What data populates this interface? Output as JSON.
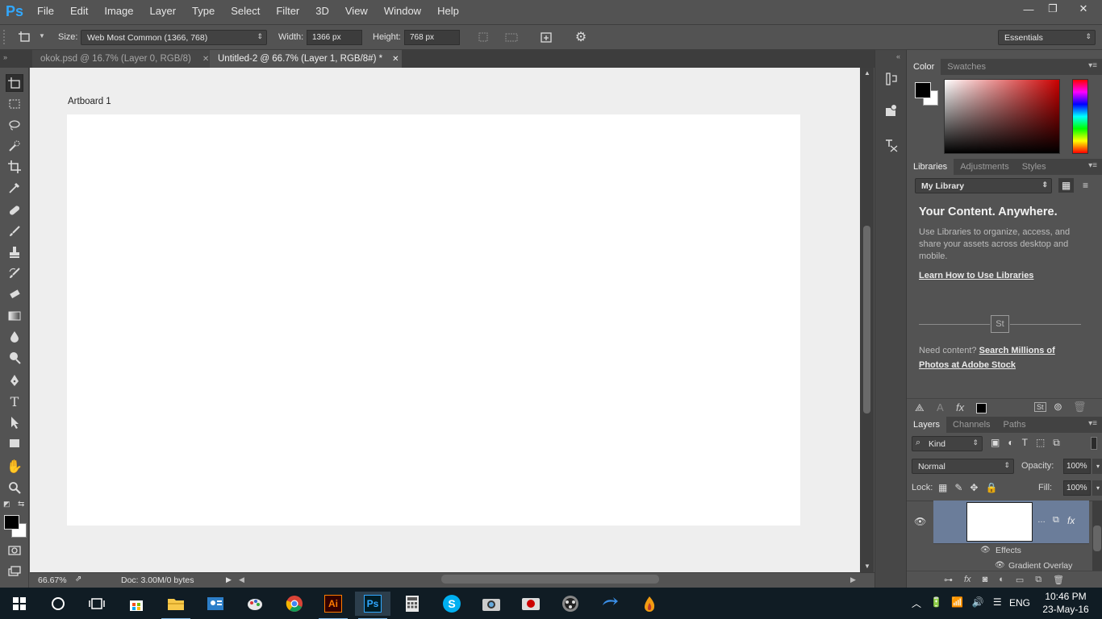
{
  "menubar": {
    "logo": "Ps",
    "items": [
      "File",
      "Edit",
      "Image",
      "Layer",
      "Type",
      "Select",
      "Filter",
      "3D",
      "View",
      "Window",
      "Help"
    ],
    "minimize": "—",
    "restore": "❐",
    "close": "✕"
  },
  "options": {
    "size_label": "Size:",
    "size_value": "Web Most Common (1366, 768)",
    "width_label": "Width:",
    "width_value": "1366 px",
    "height_label": "Height:",
    "height_value": "768 px",
    "workspace": "Essentials"
  },
  "tabs": [
    {
      "label": "okok.psd @ 16.7% (Layer 0, RGB/8)",
      "active": false
    },
    {
      "label": "Untitled-2 @ 66.7% (Layer 1, RGB/8#) *",
      "active": true
    }
  ],
  "canvas": {
    "artboard_label": "Artboard 1",
    "background": "#eeeeee",
    "artboard_color": "#ffffff"
  },
  "status": {
    "zoom": "66.67%",
    "doc": "Doc: 3.00M/0 bytes"
  },
  "color_panel": {
    "tabs": [
      "Color",
      "Swatches"
    ],
    "foreground": "#000000",
    "background": "#ffffff",
    "hue_color": "#cc0000"
  },
  "libraries": {
    "tabs": [
      "Libraries",
      "Adjustments",
      "Styles"
    ],
    "library_select": "My Library",
    "headline": "Your Content. Anywhere.",
    "body": "Use Libraries to organize, access, and share your assets across desktop and mobile.",
    "learn_link": "Learn How to Use Libraries",
    "st_badge": "St",
    "need_content": "Need content?",
    "stock_link": "Search Millions of Photos at Adobe Stock"
  },
  "layers": {
    "tabs": [
      "Layers",
      "Channels",
      "Paths"
    ],
    "filter": "Kind",
    "blend_mode": "Normal",
    "opacity_label": "Opacity:",
    "opacity_value": "100%",
    "lock_label": "Lock:",
    "fill_label": "Fill:",
    "fill_value": "100%",
    "effects_label": "Effects",
    "gradient_label": "Gradient Overlay",
    "selected_color": "#6b7d9a"
  },
  "taskbar": {
    "time": "10:46 PM",
    "date": "23-May-16",
    "lang": "ENG",
    "apps": [
      {
        "name": "explorer",
        "glyph": "▬"
      },
      {
        "name": "store",
        "glyph": "🛍"
      },
      {
        "name": "illustrator",
        "glyph": "Ai"
      },
      {
        "name": "photoshop",
        "glyph": "Ps"
      },
      {
        "name": "skype",
        "glyph": "S"
      }
    ]
  }
}
